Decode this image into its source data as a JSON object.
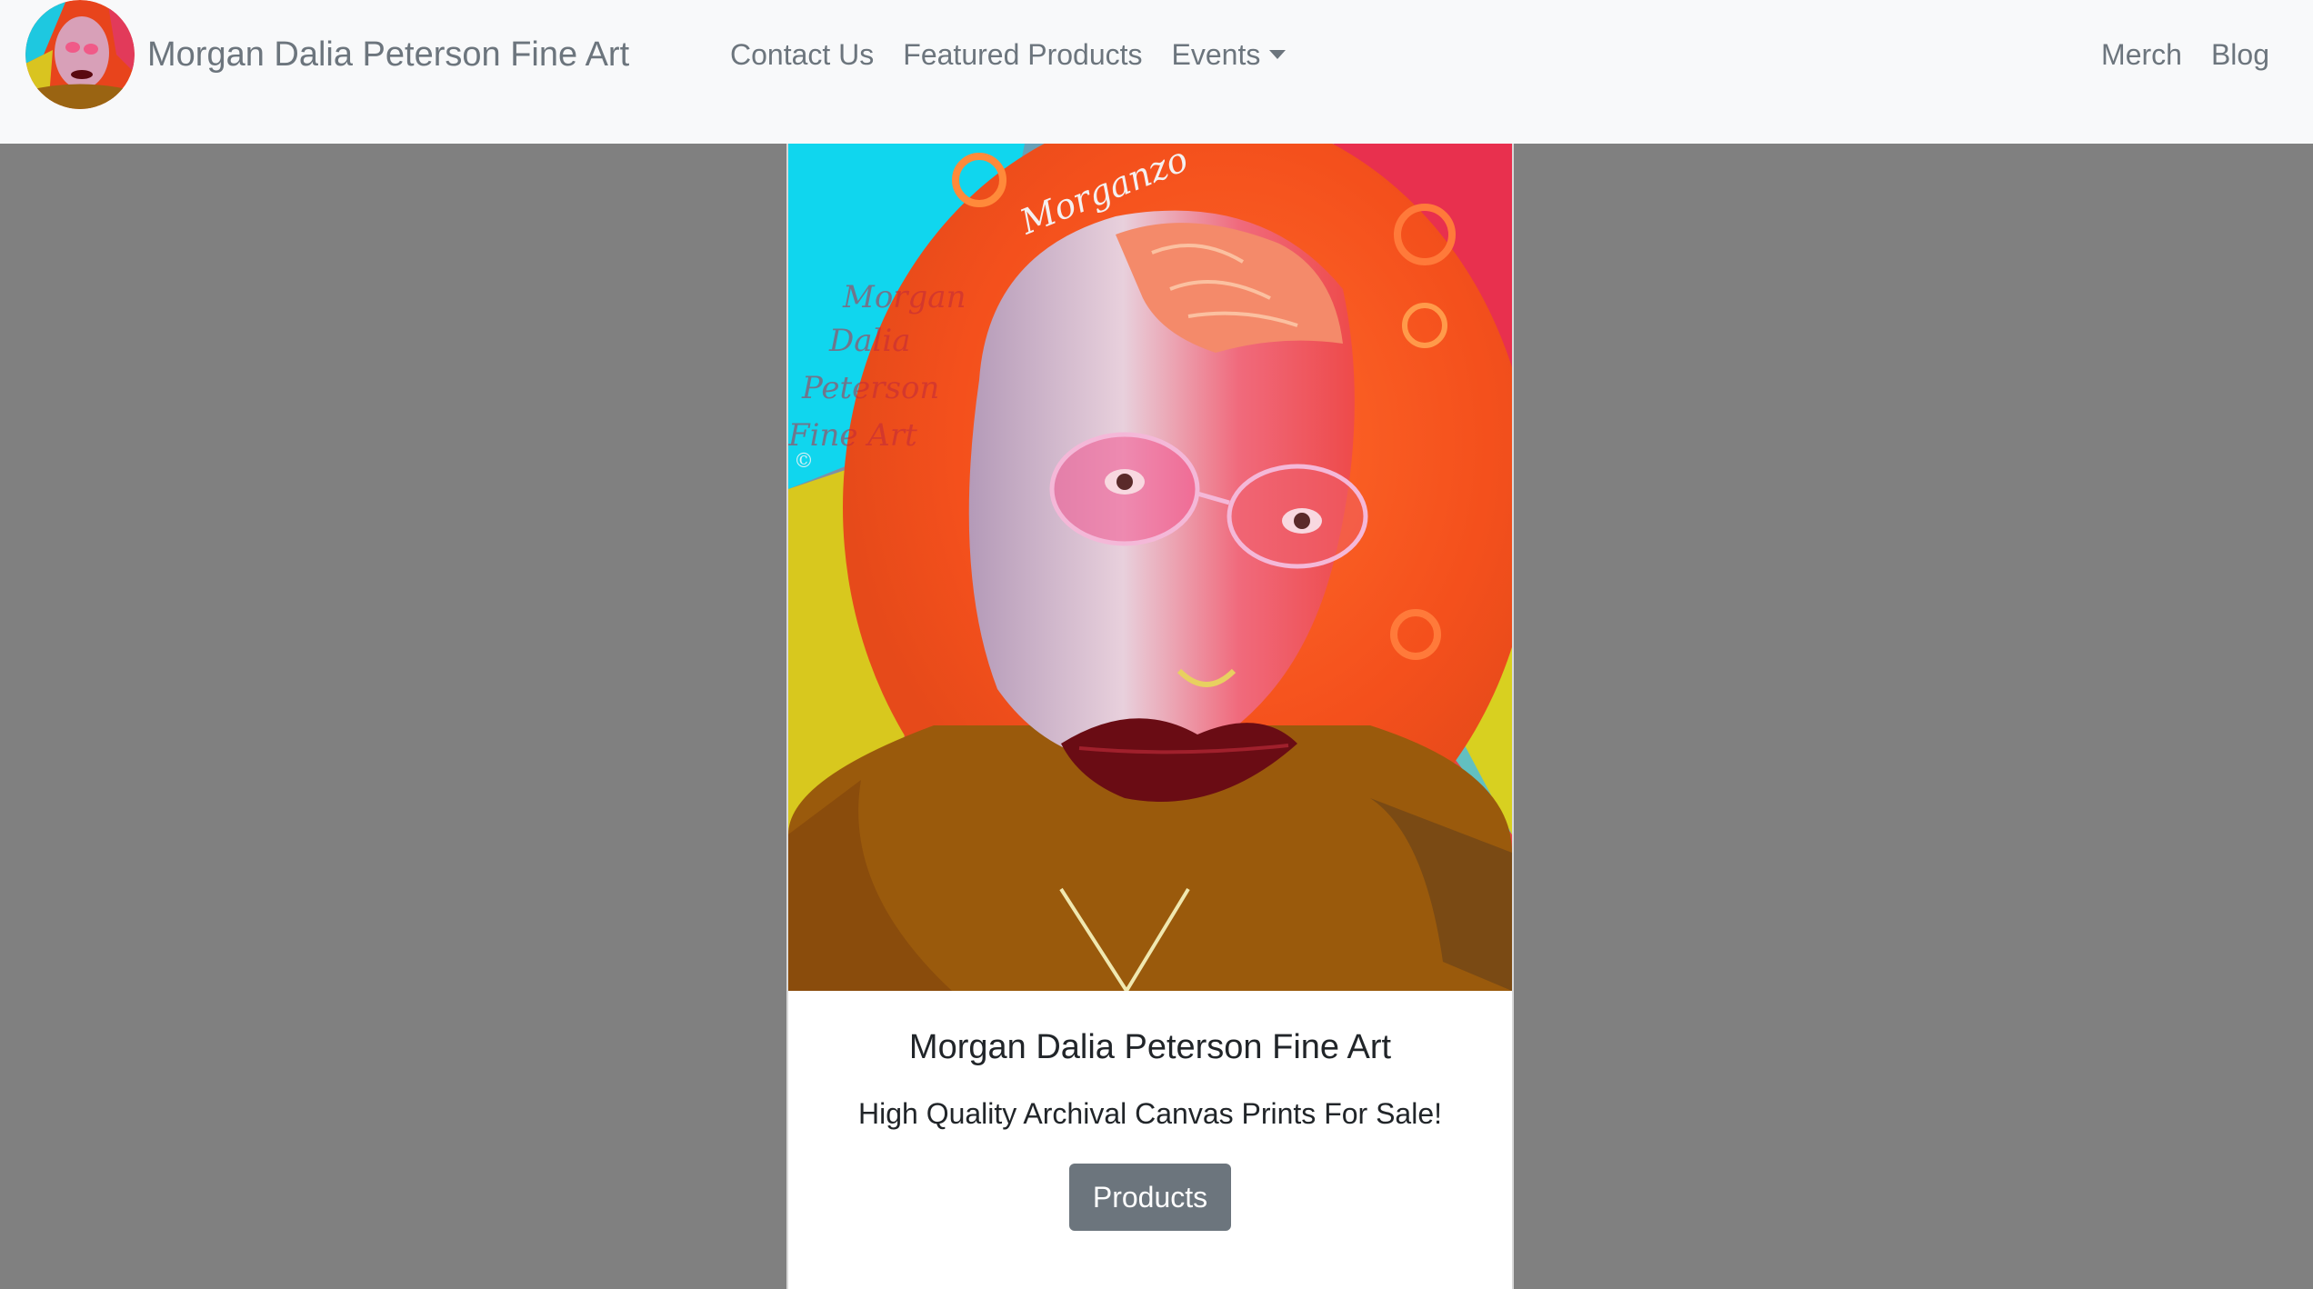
{
  "navbar": {
    "brand_name": "Morgan Dalia Peterson Fine Art",
    "links": {
      "contact": "Contact Us",
      "featured": "Featured Products",
      "events": "Events",
      "merch": "Merch",
      "blog": "Blog"
    }
  },
  "card": {
    "title": "Morgan Dalia Peterson Fine Art",
    "text": "High Quality Archival Canvas Prints For Sale!",
    "button_label": "Products"
  },
  "artwork": {
    "signature": "Morganzo",
    "watermark": [
      "Morgan",
      "Dalia",
      "Peterson",
      "Fine Art",
      "©"
    ]
  },
  "colors": {
    "page_background": "#808080",
    "navbar_background": "#f8f9fa",
    "nav_text": "#6c757d",
    "button_background": "#6c757d",
    "heading_text": "#212529"
  }
}
